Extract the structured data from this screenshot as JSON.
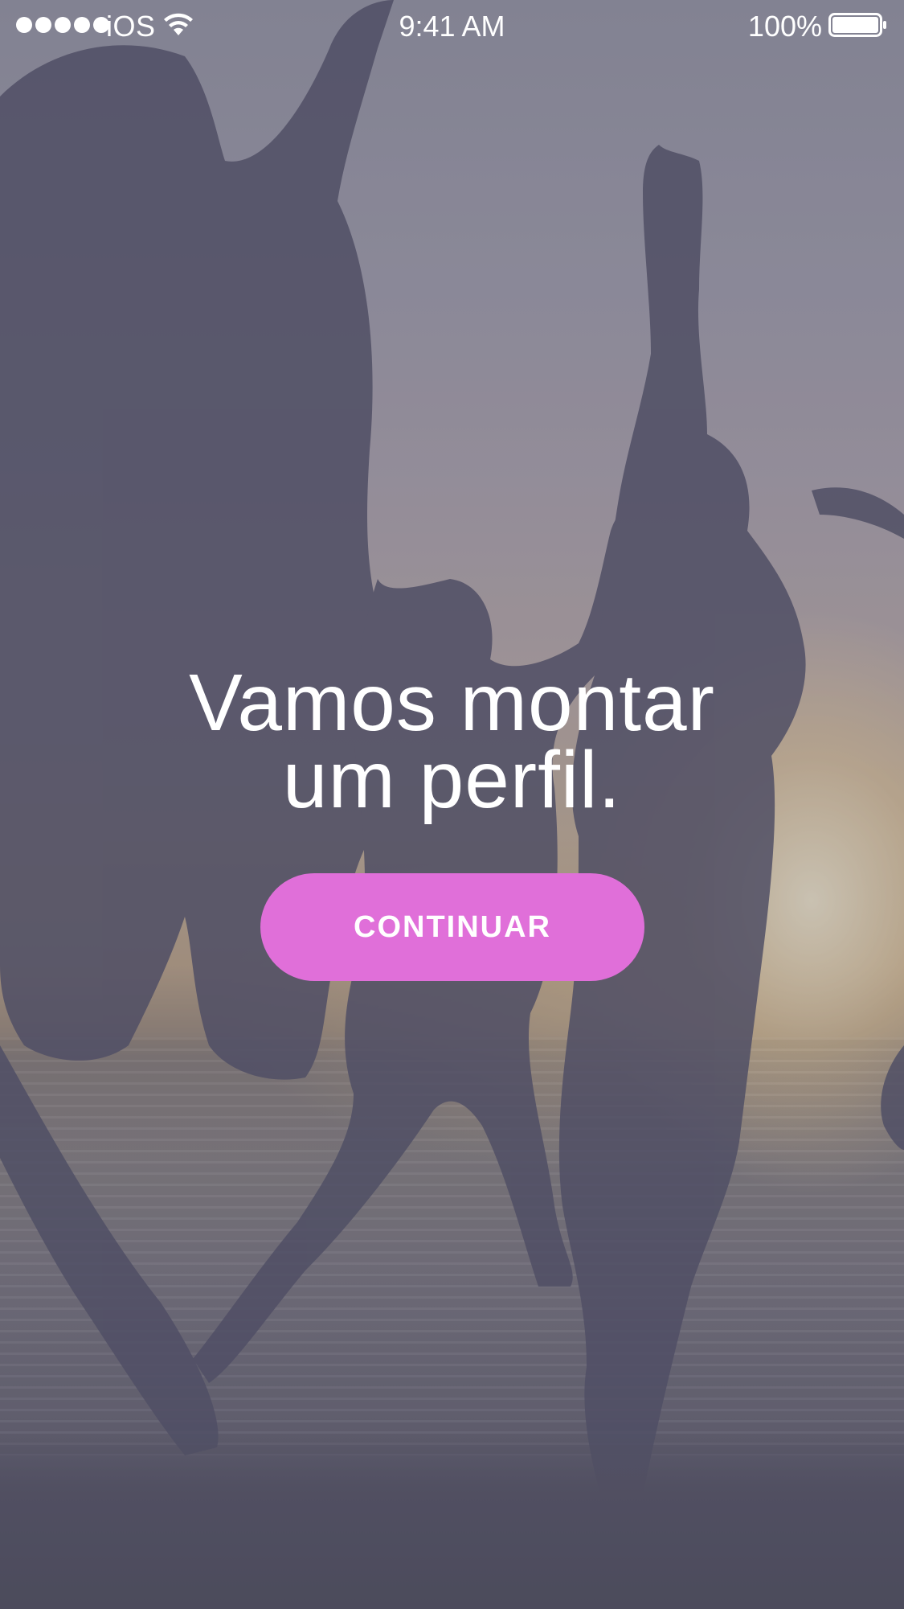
{
  "status_bar": {
    "carrier": "iOS",
    "time": "9:41 AM",
    "battery_percent": "100%",
    "battery_level": 1.0,
    "signal_bars": 5,
    "icons": [
      "signal-dots-icon",
      "wifi-icon",
      "battery-icon"
    ]
  },
  "onboarding": {
    "headline_line1": "Vamos montar",
    "headline_line2": "um perfil.",
    "continue_label": "CONTINUAR"
  },
  "colors": {
    "accent": "#e06fd9",
    "text": "#ffffff",
    "overlay": "#46445a"
  }
}
